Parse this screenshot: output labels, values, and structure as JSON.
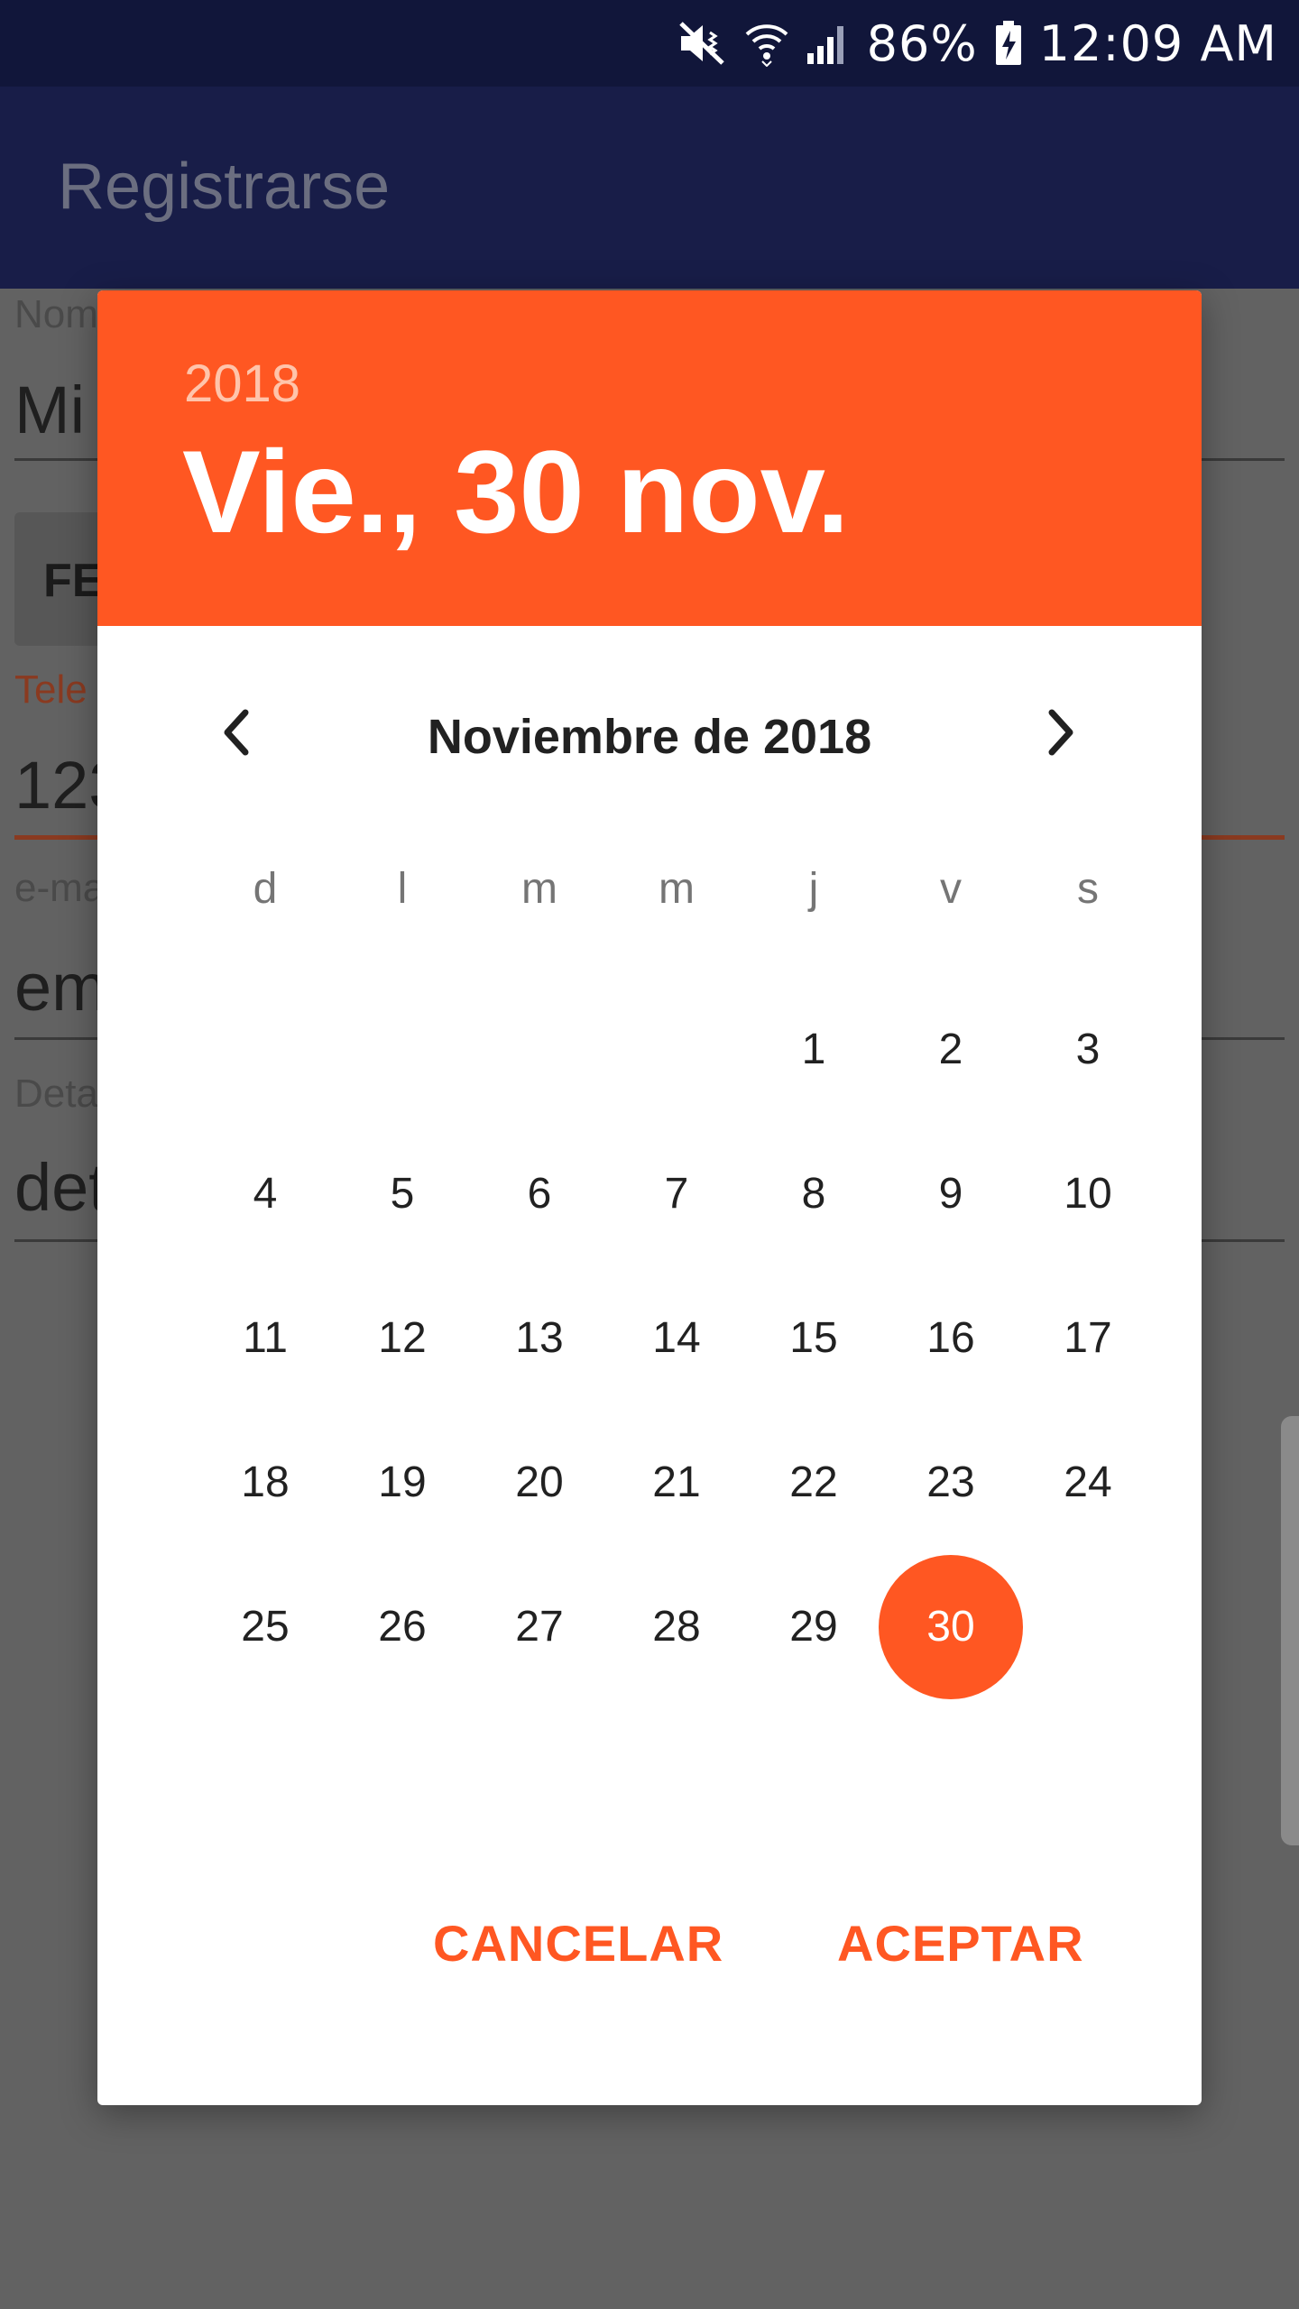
{
  "status_bar": {
    "battery": "86%",
    "time": "12:09 AM",
    "icons": [
      "mute-vibrate-icon",
      "wifi-icon",
      "signal-icon",
      "battery-charging-icon"
    ]
  },
  "app_bar": {
    "title": "Registrarse"
  },
  "form": {
    "name_label": "Nom",
    "name_value": "Mi",
    "date_button": "FE",
    "phone_label": "Tele",
    "phone_value": "123",
    "email_label": "e-ma",
    "email_value": "em",
    "details_label": "Deta",
    "details_value": "det"
  },
  "dialog": {
    "year": "2018",
    "selected_date": "Vie., 30 nov.",
    "month_label": "Noviembre de 2018",
    "weekdays": [
      "d",
      "l",
      "m",
      "m",
      "j",
      "v",
      "s"
    ],
    "weeks": [
      [
        "",
        "",
        "",
        "",
        "1",
        "2",
        "3"
      ],
      [
        "4",
        "5",
        "6",
        "7",
        "8",
        "9",
        "10"
      ],
      [
        "11",
        "12",
        "13",
        "14",
        "15",
        "16",
        "17"
      ],
      [
        "18",
        "19",
        "20",
        "21",
        "22",
        "23",
        "24"
      ],
      [
        "25",
        "26",
        "27",
        "28",
        "29",
        "30",
        ""
      ]
    ],
    "selected_day": "30",
    "cancel_label": "CANCELAR",
    "accept_label": "ACEPTAR"
  },
  "colors": {
    "accent": "#ff5722",
    "status_bar": "#11163a",
    "app_bar": "#181d48"
  }
}
